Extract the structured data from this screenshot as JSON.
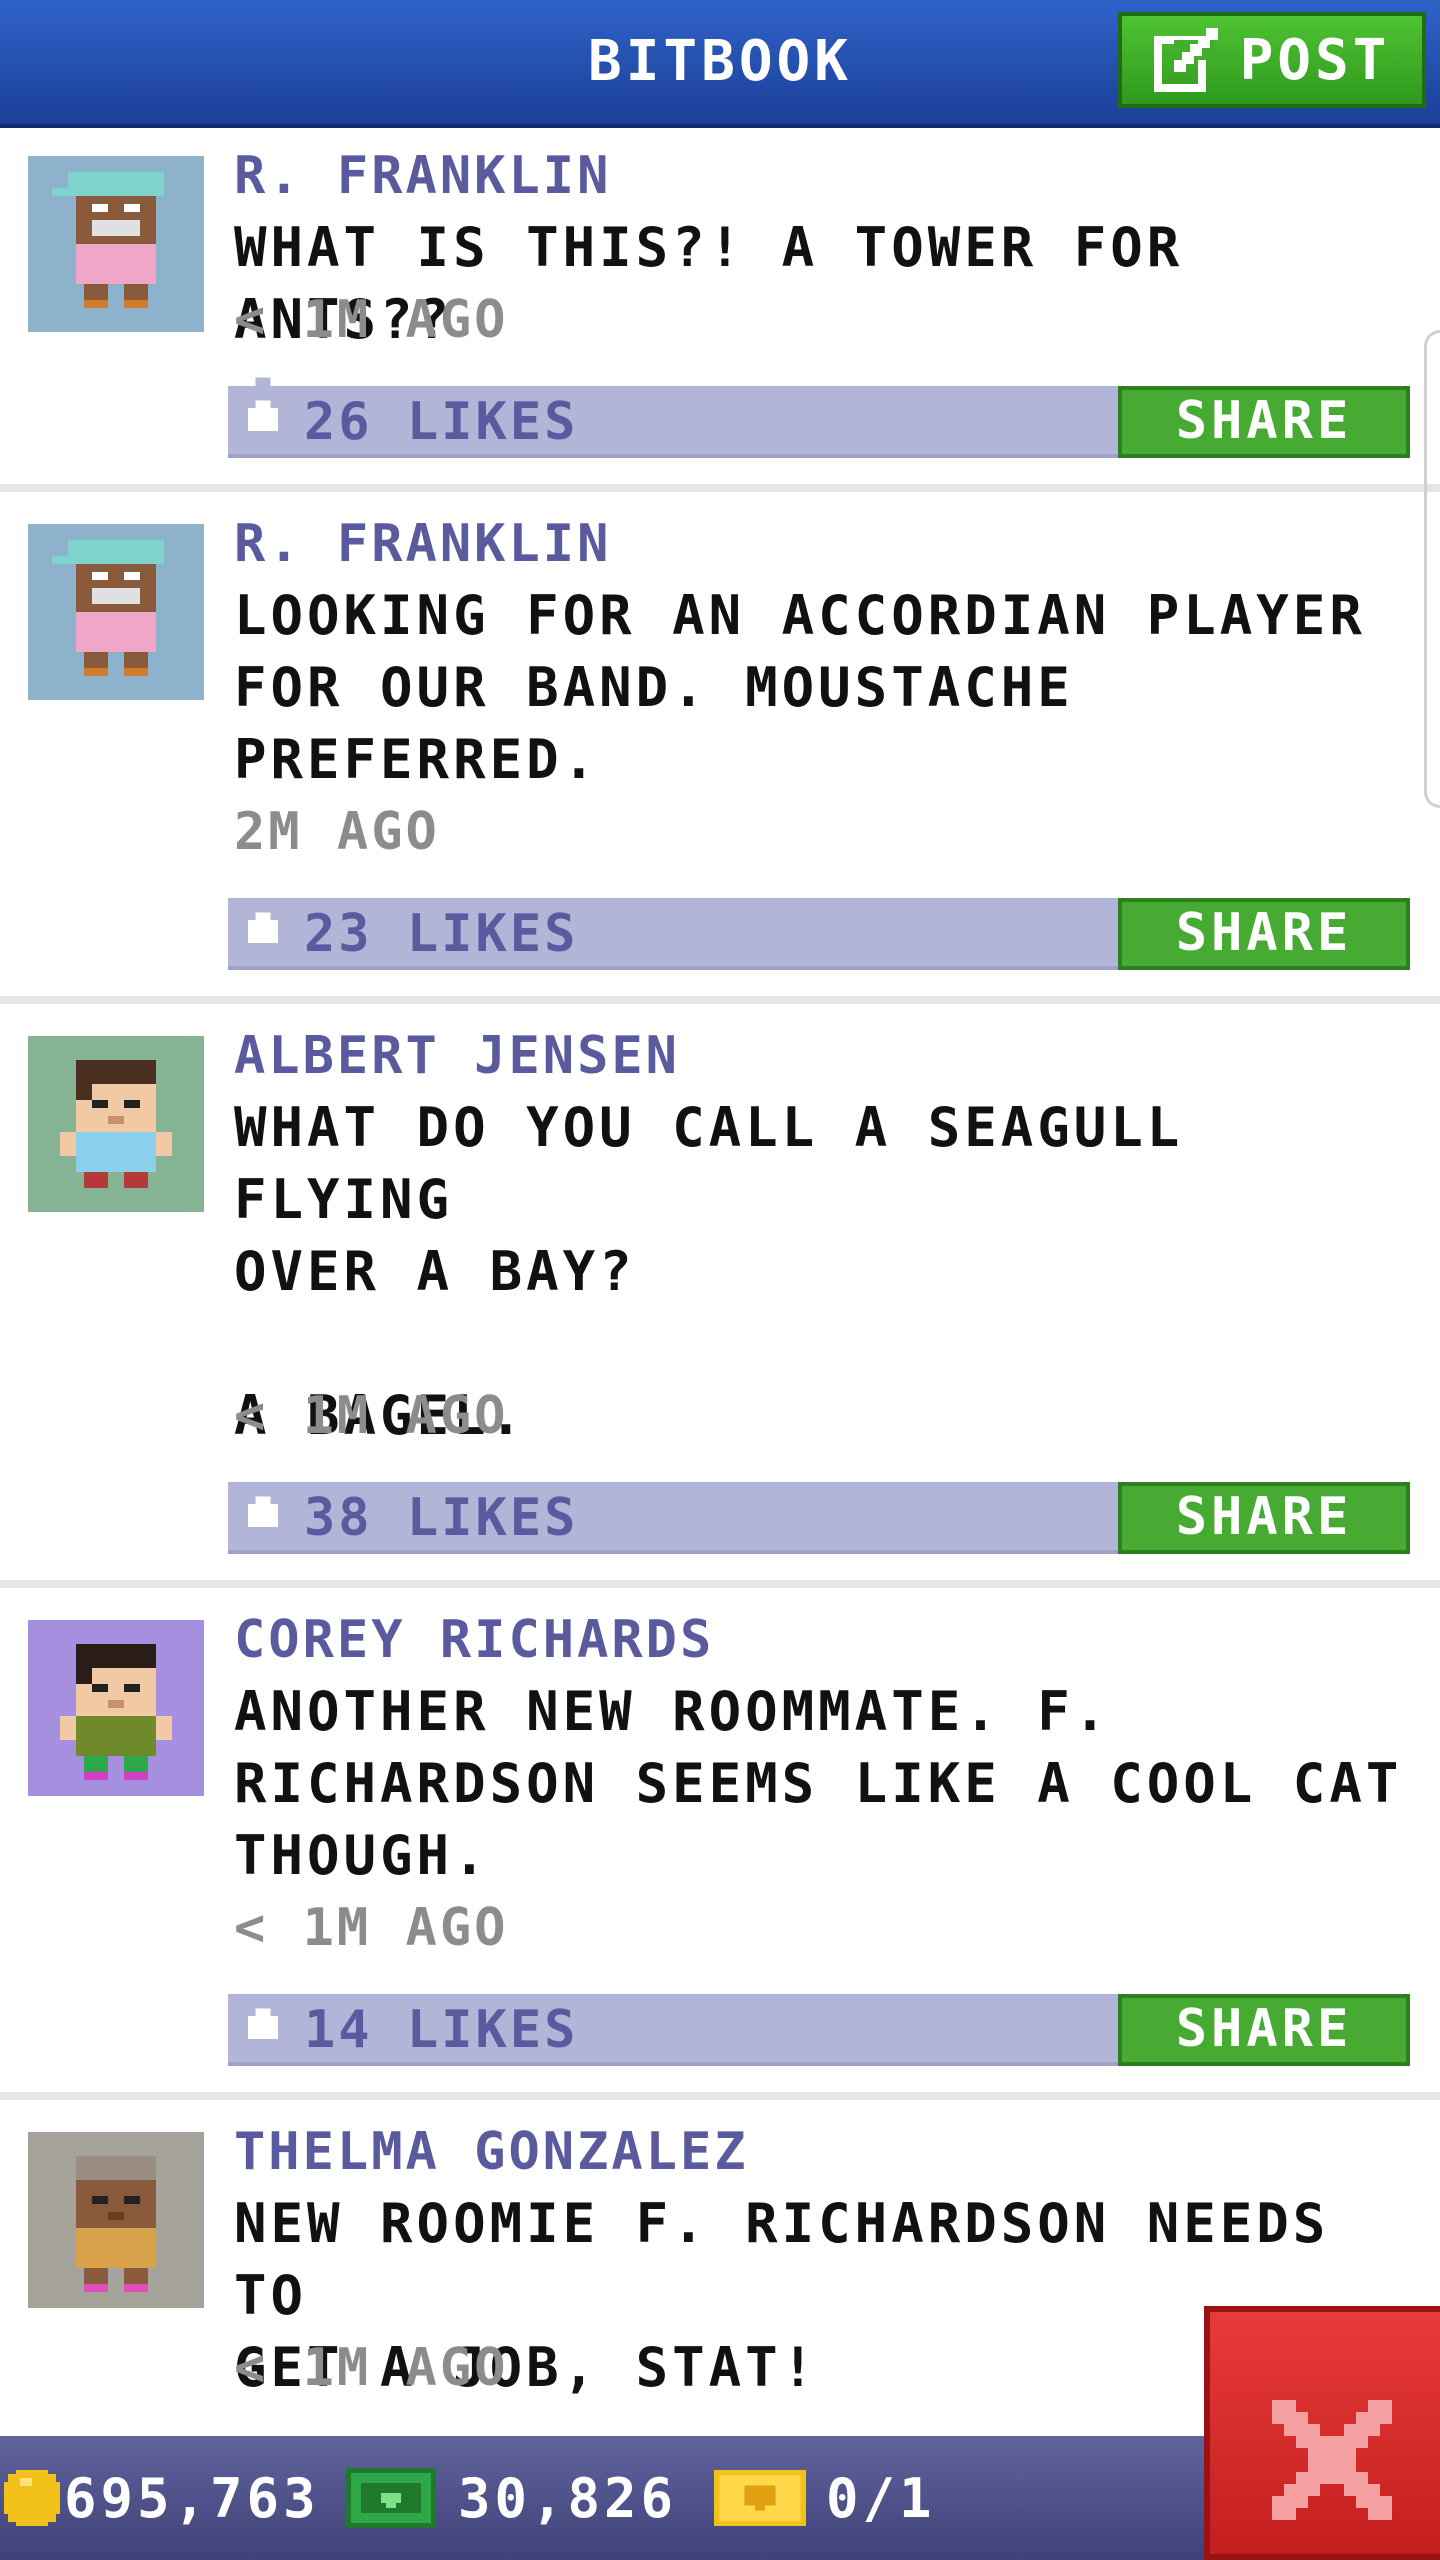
{
  "header": {
    "title": "BITBOOK",
    "post_label": "POST"
  },
  "posts": [
    {
      "author": "R. FRANKLIN",
      "message": "WHAT IS THIS?! A TOWER FOR ANTS??",
      "time": "< 1M AGO",
      "likes": "26 LIKES",
      "share": "SHARE"
    },
    {
      "author": "R. FRANKLIN",
      "message": "LOOKING FOR AN ACCORDIAN PLAYER\nFOR OUR BAND. MOUSTACHE\nPREFERRED.",
      "time": "2M AGO",
      "likes": "23 LIKES",
      "share": "SHARE"
    },
    {
      "author": "ALBERT JENSEN",
      "message": "WHAT DO YOU CALL A SEAGULL FLYING\nOVER A BAY?\n\nA BAGEL.",
      "time": "< 1M AGO",
      "likes": "38 LIKES",
      "share": "SHARE"
    },
    {
      "author": "COREY RICHARDS",
      "message": "ANOTHER NEW ROOMMATE. F.\nRICHARDSON SEEMS LIKE A COOL CAT\nTHOUGH.",
      "time": "< 1M AGO",
      "likes": "14 LIKES",
      "share": "SHARE"
    },
    {
      "author": "THELMA GONZALEZ",
      "message": "NEW ROOMIE F. RICHARDSON NEEDS TO\nGET A JOB, STAT!",
      "time": "< 1M AGO"
    }
  ],
  "bottom_bar": {
    "coins": "695,763",
    "bux": "30,826",
    "tickets": "0/1"
  },
  "colors": {
    "header_blue": "#2f63c9",
    "post_green": "#4fc232",
    "author_purple": "#5a5a9e",
    "likes_bar": "#b3b5d8",
    "share_green": "#47aa32",
    "close_red": "#e83a3a",
    "avatar_bg_1": "#8fb2cc",
    "avatar_bg_2": "#86b393",
    "avatar_bg_3": "#a78fe0",
    "avatar_bg_4": "#a6a39b"
  },
  "icons": {
    "post": "edit-icon",
    "like": "thumbs-up-icon",
    "close": "close-icon",
    "coin": "coin-icon",
    "bux": "bux-icon",
    "ticket": "golden-ticket-icon"
  }
}
